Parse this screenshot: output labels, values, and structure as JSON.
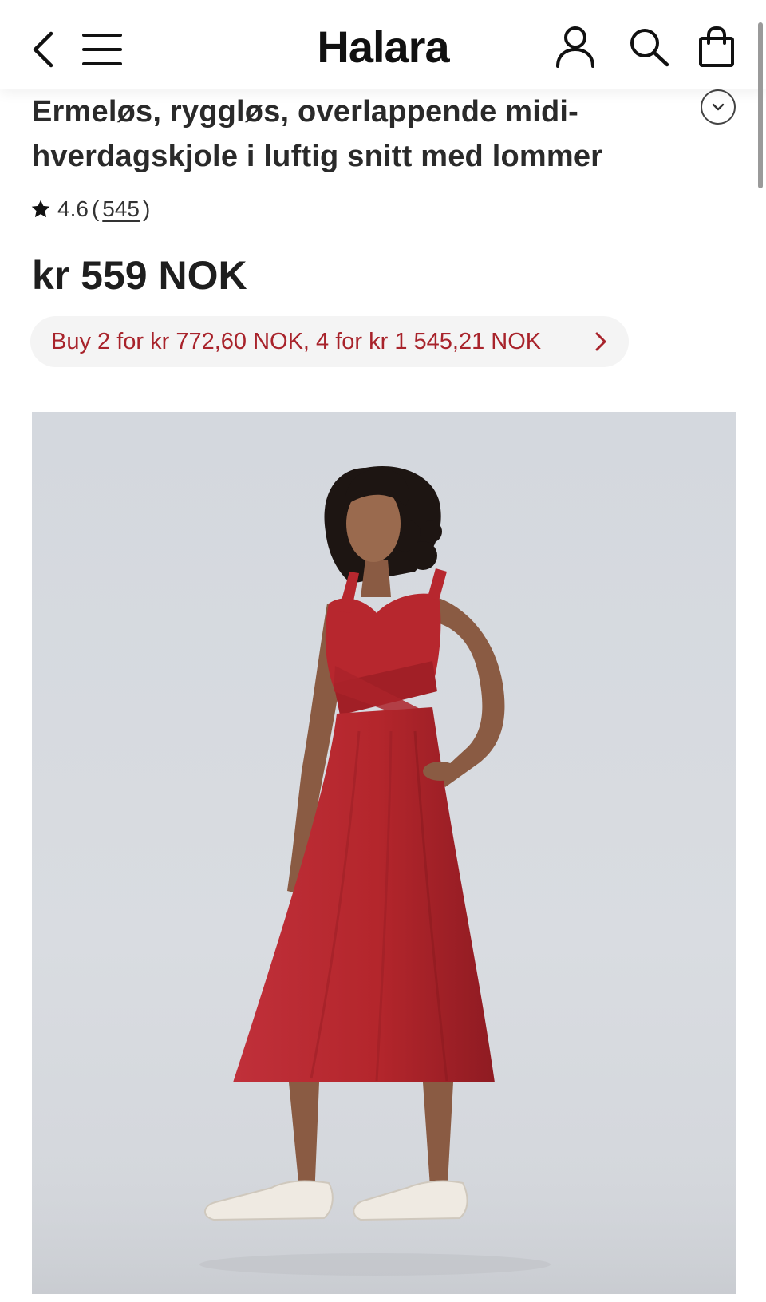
{
  "header": {
    "logo": "Halara",
    "icons": [
      "chevron-left-icon",
      "hamburger-menu-icon",
      "user-icon",
      "search-icon",
      "shopping-bag-icon"
    ]
  },
  "product": {
    "title": "Ermeløs, ryggløs, overlappende midi-hverdagskjole i luftig snitt med lommer",
    "rating": "4.6",
    "rating_open": "(",
    "review_count": "545",
    "rating_close": ")",
    "price": "kr 559 NOK",
    "promo": "Buy 2 for kr 772,60 NOK, 4 for kr 1 545,21 NOK"
  },
  "colors": {
    "promo_text": "#a8232b",
    "dress": "#b4262c",
    "image_background": "#d6d9de"
  }
}
